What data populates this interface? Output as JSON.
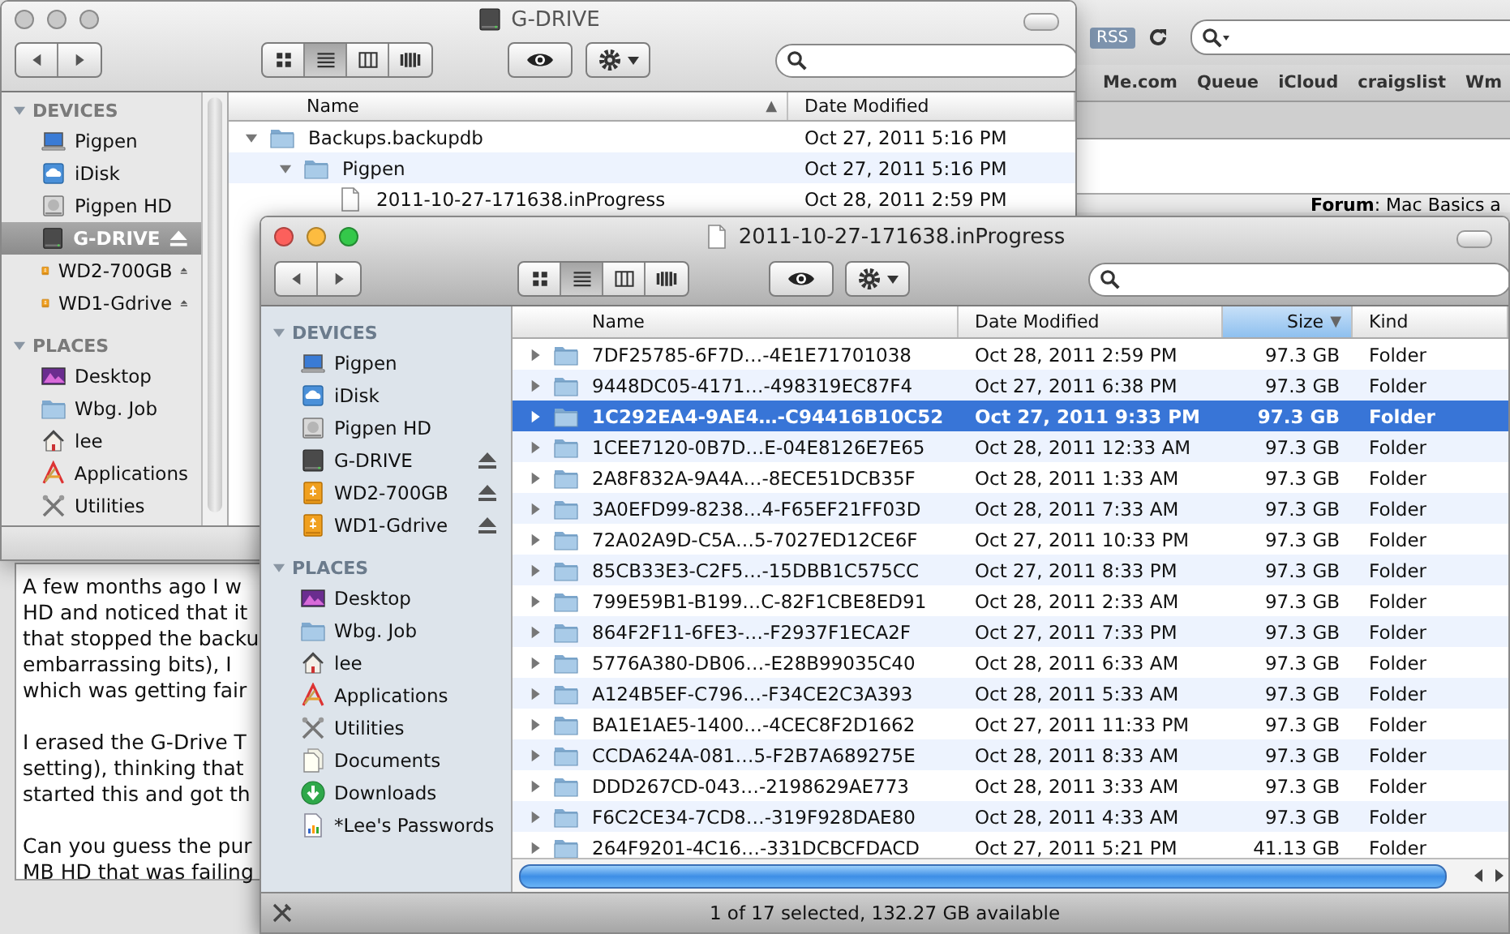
{
  "browser": {
    "rss_label": "RSS",
    "bookmarks": [
      "Me.com",
      "Queue",
      "iCloud",
      "craigslist",
      "Wm"
    ],
    "forum": "**Forum**: Mac Basics a",
    "post_paragraphs": [
      [
        "A few months ago I w",
        "HD and noticed that it",
        "that stopped the backu",
        "embarrassing bits), I",
        "which was getting fair"
      ],
      [
        "I erased the G-Drive T",
        "setting), thinking that",
        "started this and got th"
      ],
      [
        "Can you guess the pur",
        "MB HD that was failing"
      ]
    ]
  },
  "back_window": {
    "title": "G-DRIVE",
    "active": false,
    "views": [
      {
        "kind": "icon",
        "selected": false
      },
      {
        "kind": "list",
        "selected": true
      },
      {
        "kind": "column",
        "selected": false
      },
      {
        "kind": "coverflow",
        "selected": false
      }
    ],
    "sidebar": [
      {
        "heading": "DEVICES",
        "expanded": true,
        "items": [
          {
            "label": "Pigpen",
            "kind": "laptop",
            "selected": false,
            "eject": false
          },
          {
            "label": "iDisk",
            "kind": "idisk",
            "selected": false,
            "eject": false
          },
          {
            "label": "Pigpen HD",
            "kind": "hd",
            "selected": false,
            "eject": false
          },
          {
            "label": "G-DRIVE",
            "kind": "external",
            "selected": true,
            "eject": true
          },
          {
            "label": "WD2-700GB",
            "kind": "usb",
            "selected": false,
            "eject": true
          },
          {
            "label": "WD1-Gdrive",
            "kind": "usb",
            "selected": false,
            "eject": true
          }
        ]
      },
      {
        "heading": "PLACES",
        "expanded": true,
        "items": [
          {
            "label": "Desktop",
            "kind": "desktop",
            "selected": false,
            "eject": false
          },
          {
            "label": "Wbg. Job",
            "kind": "folder",
            "selected": false,
            "eject": false
          },
          {
            "label": "lee",
            "kind": "home",
            "selected": false,
            "eject": false
          },
          {
            "label": "Applications",
            "kind": "apps",
            "selected": false,
            "eject": false
          },
          {
            "label": "Utilities",
            "kind": "utilities",
            "selected": false,
            "eject": false
          }
        ]
      }
    ],
    "columns": [
      {
        "label": "Name",
        "sort_arrow": "▲"
      },
      {
        "label": "Date Modified"
      }
    ],
    "rows": [
      {
        "name": "Backups.backupdb",
        "date": "Oct 27, 2011 5:16 PM",
        "expanded": true,
        "selected": false,
        "children": [
          {
            "name": "Pigpen",
            "date": "Oct 27, 2011 5:16 PM",
            "expanded": true,
            "selected": false,
            "children": [
              {
                "name": "2011-10-27-171638.inProgress",
                "date": "Oct 28, 2011 2:59 PM",
                "selected": false
              }
            ]
          }
        ]
      }
    ]
  },
  "front_window": {
    "title": "2011-10-27-171638.inProgress",
    "active": true,
    "views": [
      {
        "kind": "icon",
        "selected": false
      },
      {
        "kind": "list",
        "selected": true
      },
      {
        "kind": "column",
        "selected": false
      },
      {
        "kind": "coverflow",
        "selected": false
      }
    ],
    "sidebar": [
      {
        "heading": "DEVICES",
        "expanded": true,
        "items": [
          {
            "label": "Pigpen",
            "kind": "laptop",
            "selected": false,
            "eject": false
          },
          {
            "label": "iDisk",
            "kind": "idisk",
            "selected": false,
            "eject": false
          },
          {
            "label": "Pigpen HD",
            "kind": "hd",
            "selected": false,
            "eject": false
          },
          {
            "label": "G-DRIVE",
            "kind": "external",
            "selected": false,
            "eject": true
          },
          {
            "label": "WD2-700GB",
            "kind": "usb",
            "selected": false,
            "eject": true
          },
          {
            "label": "WD1-Gdrive",
            "kind": "usb",
            "selected": false,
            "eject": true
          }
        ]
      },
      {
        "heading": "PLACES",
        "expanded": true,
        "items": [
          {
            "label": "Desktop",
            "kind": "desktop",
            "selected": false,
            "eject": false
          },
          {
            "label": "Wbg. Job",
            "kind": "folder",
            "selected": false,
            "eject": false
          },
          {
            "label": "lee",
            "kind": "home",
            "selected": false,
            "eject": false
          },
          {
            "label": "Applications",
            "kind": "apps",
            "selected": false,
            "eject": false
          },
          {
            "label": "Utilities",
            "kind": "utilities",
            "selected": false,
            "eject": false
          },
          {
            "label": "Documents",
            "kind": "documents",
            "selected": false,
            "eject": false
          },
          {
            "label": "Downloads",
            "kind": "downloads",
            "selected": false,
            "eject": false
          },
          {
            "label": "*Lee's Passwords",
            "kind": "chartdoc",
            "selected": false,
            "eject": false
          }
        ]
      }
    ],
    "columns": [
      {
        "label": "Name"
      },
      {
        "label": "Date Modified"
      },
      {
        "label": "Size",
        "sort_arrow": "▼"
      },
      {
        "label": "Kind"
      }
    ],
    "rows": [
      {
        "name": "7DF25785-6F7D…-4E1E71701038",
        "date": "Oct 28, 2011 2:59 PM",
        "size": "97.3 GB",
        "kind": "Folder",
        "expanded": false,
        "selected": false
      },
      {
        "name": "9448DC05-4171…-498319EC87F4",
        "date": "Oct 27, 2011 6:38 PM",
        "size": "97.3 GB",
        "kind": "Folder",
        "expanded": false,
        "selected": false
      },
      {
        "name": "1C292EA4-9AE4…-C94416B10C52",
        "date": "Oct 27, 2011 9:33 PM",
        "size": "97.3 GB",
        "kind": "Folder",
        "expanded": false,
        "selected": true
      },
      {
        "name": "1CEE7120-0B7D…E-04E8126E7E65",
        "date": "Oct 28, 2011 12:33 AM",
        "size": "97.3 GB",
        "kind": "Folder",
        "expanded": false,
        "selected": false
      },
      {
        "name": "2A8F832A-9A4A…-8ECE51DCB35F",
        "date": "Oct 28, 2011 1:33 AM",
        "size": "97.3 GB",
        "kind": "Folder",
        "expanded": false,
        "selected": false
      },
      {
        "name": "3A0EFD99-8238…4-F65EF21FF03D",
        "date": "Oct 28, 2011 7:33 AM",
        "size": "97.3 GB",
        "kind": "Folder",
        "expanded": false,
        "selected": false
      },
      {
        "name": "72A02A9D-C5A…5-7027ED12CE6F",
        "date": "Oct 27, 2011 10:33 PM",
        "size": "97.3 GB",
        "kind": "Folder",
        "expanded": false,
        "selected": false
      },
      {
        "name": "85CB33E3-C2F5…-15DBB1C575CC",
        "date": "Oct 27, 2011 8:33 PM",
        "size": "97.3 GB",
        "kind": "Folder",
        "expanded": false,
        "selected": false
      },
      {
        "name": "799E59B1-B199…C-82F1CBE8ED91",
        "date": "Oct 28, 2011 2:33 AM",
        "size": "97.3 GB",
        "kind": "Folder",
        "expanded": false,
        "selected": false
      },
      {
        "name": "864F2F11-6FE3-…-F2937F1ECA2F",
        "date": "Oct 27, 2011 7:33 PM",
        "size": "97.3 GB",
        "kind": "Folder",
        "expanded": false,
        "selected": false
      },
      {
        "name": "5776A380-DB06…-E28B99035C40",
        "date": "Oct 28, 2011 6:33 AM",
        "size": "97.3 GB",
        "kind": "Folder",
        "expanded": false,
        "selected": false
      },
      {
        "name": "A124B5EF-C796…-F34CE2C3A393",
        "date": "Oct 28, 2011 5:33 AM",
        "size": "97.3 GB",
        "kind": "Folder",
        "expanded": false,
        "selected": false
      },
      {
        "name": "BA1E1AE5-1400…-4CEC8F2D1662",
        "date": "Oct 27, 2011 11:33 PM",
        "size": "97.3 GB",
        "kind": "Folder",
        "expanded": false,
        "selected": false
      },
      {
        "name": "CCDA624A-081…5-F2B7A689275E",
        "date": "Oct 28, 2011 8:33 AM",
        "size": "97.3 GB",
        "kind": "Folder",
        "expanded": false,
        "selected": false
      },
      {
        "name": "DDD267CD-043…-2198629AE773",
        "date": "Oct 28, 2011 3:33 AM",
        "size": "97.3 GB",
        "kind": "Folder",
        "expanded": false,
        "selected": false
      },
      {
        "name": "F6C2CE34-7CD8…-319F928DAE80",
        "date": "Oct 28, 2011 4:33 AM",
        "size": "97.3 GB",
        "kind": "Folder",
        "expanded": false,
        "selected": false
      },
      {
        "name": "264F9201-4C16…-331DCBCFDACD",
        "date": "Oct 27, 2011 5:21 PM",
        "size": "41.13 GB",
        "kind": "Folder",
        "expanded": false,
        "selected": false
      }
    ],
    "status": "1 of 17 selected, 132.27 GB available"
  }
}
